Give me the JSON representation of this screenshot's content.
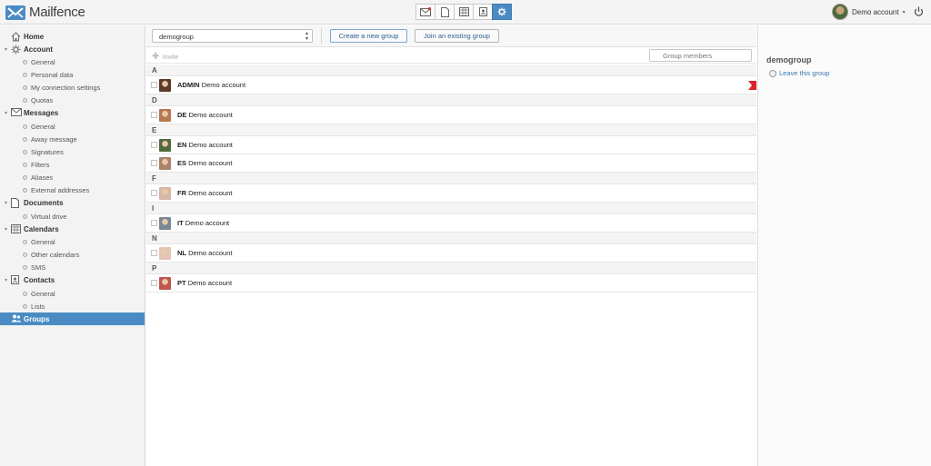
{
  "app": {
    "name": "Mailfence"
  },
  "topbar": {
    "apps": [
      {
        "name": "mail-app-icon",
        "active": false
      },
      {
        "name": "documents-app-icon",
        "active": false
      },
      {
        "name": "calendar-app-icon",
        "active": false
      },
      {
        "name": "contacts-app-icon",
        "active": false
      },
      {
        "name": "settings-app-icon",
        "active": true
      }
    ],
    "user_name": "Demo account",
    "caret": "▾"
  },
  "sidebar": {
    "items": [
      {
        "type": "section",
        "label": "Home",
        "icon": "home-icon"
      },
      {
        "type": "section",
        "label": "Account",
        "icon": "gear-icon",
        "expanded": true
      },
      {
        "type": "sub",
        "label": "General"
      },
      {
        "type": "sub",
        "label": "Personal data"
      },
      {
        "type": "sub",
        "label": "My connection settings"
      },
      {
        "type": "sub",
        "label": "Quotas"
      },
      {
        "type": "section",
        "label": "Messages",
        "icon": "envelope-icon",
        "expanded": true
      },
      {
        "type": "sub",
        "label": "General"
      },
      {
        "type": "sub",
        "label": "Away message"
      },
      {
        "type": "sub",
        "label": "Signatures"
      },
      {
        "type": "sub",
        "label": "Filters"
      },
      {
        "type": "sub",
        "label": "Aliases"
      },
      {
        "type": "sub",
        "label": "External addresses"
      },
      {
        "type": "section",
        "label": "Documents",
        "icon": "document-icon",
        "expanded": true
      },
      {
        "type": "sub",
        "label": "Virtual drive"
      },
      {
        "type": "section",
        "label": "Calendars",
        "icon": "calendar-icon",
        "expanded": true
      },
      {
        "type": "sub",
        "label": "General"
      },
      {
        "type": "sub",
        "label": "Other calendars"
      },
      {
        "type": "sub",
        "label": "SMS"
      },
      {
        "type": "section",
        "label": "Contacts",
        "icon": "contacts-icon",
        "expanded": true
      },
      {
        "type": "sub",
        "label": "General"
      },
      {
        "type": "sub",
        "label": "Lists"
      },
      {
        "type": "section",
        "label": "Groups",
        "icon": "groups-icon",
        "active": true
      }
    ]
  },
  "toolbar": {
    "group_select_value": "demogroup",
    "create_label": "Create a new group",
    "join_label": "Join an existing group",
    "invite_label": "Invite",
    "search_placeholder": "Group members"
  },
  "members": [
    {
      "letter": "A",
      "people": [
        {
          "code": "ADMIN",
          "name": "Demo account",
          "admin": true,
          "avatar_color": "#5b3a29"
        }
      ]
    },
    {
      "letter": "D",
      "people": [
        {
          "code": "DE",
          "name": "Demo account",
          "avatar_color": "#b7774f"
        }
      ]
    },
    {
      "letter": "E",
      "people": [
        {
          "code": "EN",
          "name": "Demo account",
          "avatar_color": "#4f6b3d"
        },
        {
          "code": "ES",
          "name": "Demo account",
          "avatar_color": "#a9836b"
        }
      ]
    },
    {
      "letter": "F",
      "people": [
        {
          "code": "FR",
          "name": "Demo account",
          "avatar_color": "#d6b6a5"
        }
      ]
    },
    {
      "letter": "I",
      "people": [
        {
          "code": "IT",
          "name": "Demo account",
          "avatar_color": "#7a8796"
        }
      ]
    },
    {
      "letter": "N",
      "people": [
        {
          "code": "NL",
          "name": "Demo account",
          "avatar_color": "#e3c4b4"
        }
      ]
    },
    {
      "letter": "P",
      "people": [
        {
          "code": "PT",
          "name": "Demo account",
          "avatar_color": "#c0564f"
        }
      ]
    }
  ],
  "right_panel": {
    "title": "demogroup",
    "leave_label": "Leave this group"
  },
  "colors": {
    "accent": "#4a8bc4",
    "link": "#2d5f8f",
    "admin_flag": "#d9252a"
  }
}
